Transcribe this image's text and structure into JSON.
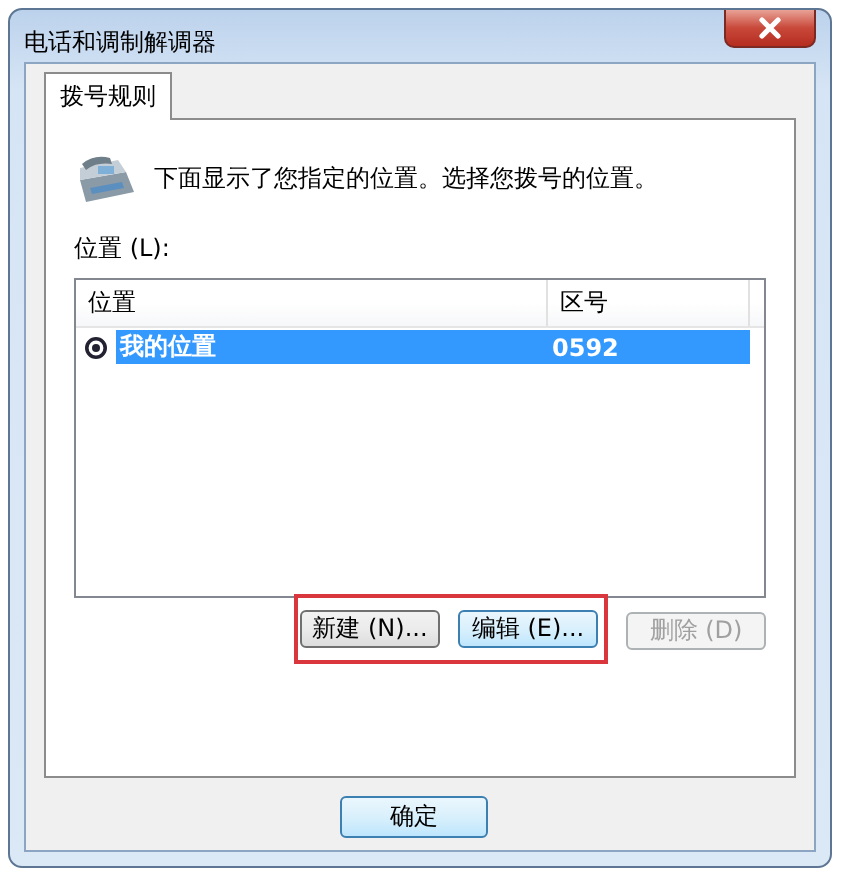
{
  "window": {
    "title": "电话和调制解调器"
  },
  "tabs": [
    {
      "label": "拨号规则",
      "selected": true
    }
  ],
  "intro": "下面显示了您指定的位置。选择您拨号的位置。",
  "locations": {
    "label": "位置 (L):",
    "columns": [
      "位置",
      "区号"
    ],
    "rows": [
      {
        "cells": [
          "我的位置",
          "0592"
        ],
        "selected": true,
        "current": true
      }
    ]
  },
  "list_buttons": [
    {
      "label": "新建 (N)...",
      "disabled": false,
      "highlighted": true
    },
    {
      "label": "编辑 (E)...",
      "disabled": false,
      "highlighted": true
    },
    {
      "label": "删除 (D)",
      "disabled": true,
      "highlighted": false
    }
  ],
  "dialog_buttons": [
    {
      "label": "确定"
    }
  ]
}
